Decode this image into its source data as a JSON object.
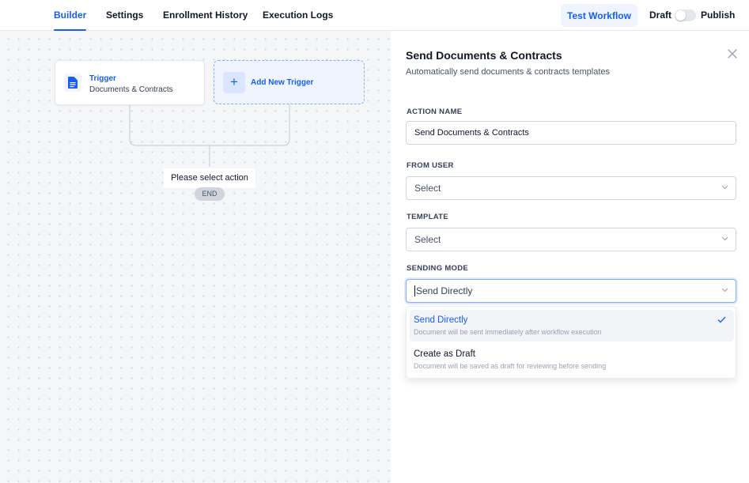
{
  "nav": {
    "tabs": [
      {
        "label": "Builder",
        "active": true
      },
      {
        "label": "Settings"
      },
      {
        "label": "Enrollment History"
      },
      {
        "label": "Execution Logs"
      }
    ],
    "test_button": "Test Workflow",
    "draft_label": "Draft",
    "publish_label": "Publish",
    "publish_enabled": false
  },
  "canvas": {
    "trigger": {
      "title": "Trigger",
      "subtitle": "Documents & Contracts",
      "icon": "document-icon"
    },
    "add_trigger": {
      "label": "Add New Trigger",
      "icon": "plus-icon"
    },
    "select_action": "Please select action",
    "end_label": "END"
  },
  "panel": {
    "title": "Send Documents & Contracts",
    "subtitle": "Automatically send documents & contracts templates",
    "fields": {
      "action_name": {
        "label": "ACTION NAME",
        "value": "Send Documents & Contracts"
      },
      "from_user": {
        "label": "FROM USER",
        "placeholder": "Select"
      },
      "template": {
        "label": "TEMPLATE",
        "placeholder": "Select"
      },
      "sending_mode": {
        "label": "SENDING MODE",
        "value": "Send Directly"
      }
    },
    "sending_mode_options": [
      {
        "title": "Send Directly",
        "description": "Document will be sent immediately after workflow execution",
        "selected": true
      },
      {
        "title": "Create as Draft",
        "description": "Document will be saved as draft for reviewing before sending",
        "selected": false
      }
    ]
  },
  "colors": {
    "accent": "#155eef",
    "accent_light": "#eff4ff",
    "border": "#d0d5dd"
  }
}
